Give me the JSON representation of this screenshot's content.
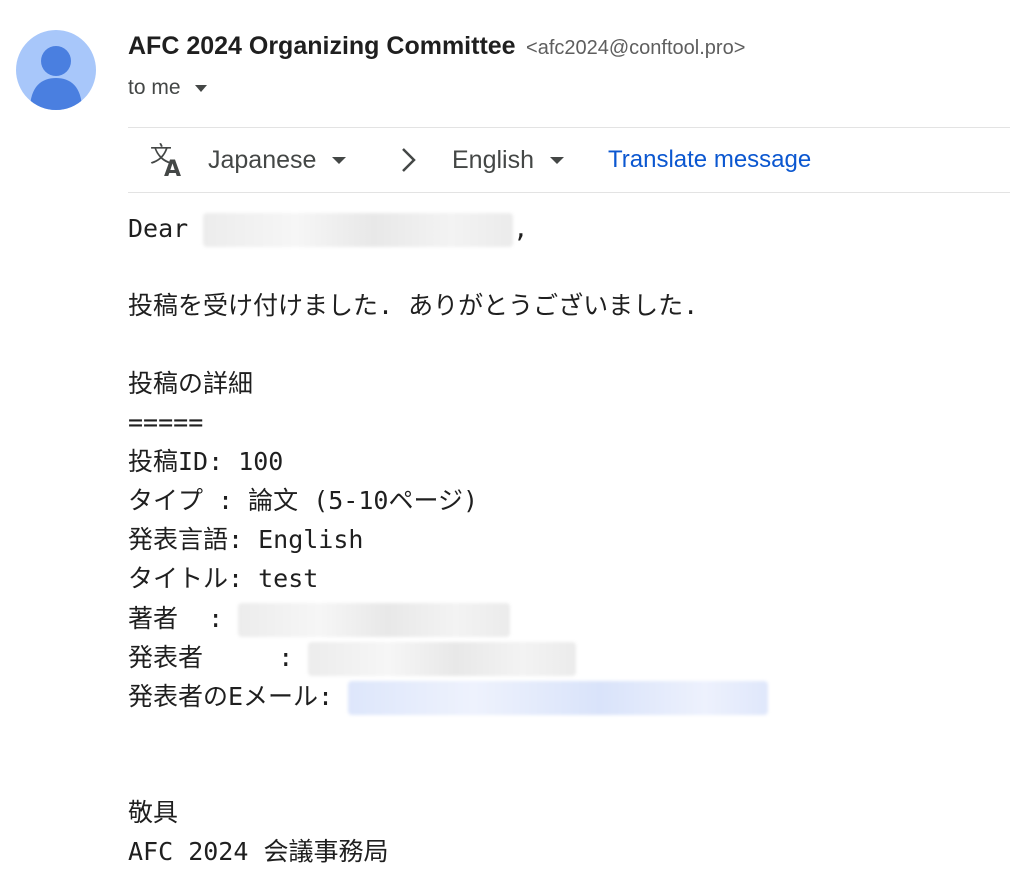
{
  "sender": {
    "name": "AFC 2024 Organizing Committee",
    "email": "<afc2024@conftool.pro>",
    "recipient": "to me"
  },
  "translate_bar": {
    "source_language": "Japanese",
    "target_language": "English",
    "translate_link": "Translate message"
  },
  "message": {
    "greeting": "Dear",
    "greeting_comma": ",",
    "thanks": "投稿を受け付けました. ありがとうございました.",
    "details_heading": "投稿の詳細",
    "separator": "=====",
    "submission_id": "投稿ID: 100",
    "type_line": "タイプ : 論文 (5-10ページ)",
    "language_line": "発表言語: English",
    "title_line": "タイトル: test",
    "author_label": "著者  :",
    "presenter_label": "発表者     :",
    "presenter_email_label": "発表者のEメール:",
    "closing": "敬具",
    "signature": "AFC 2024 会議事務局"
  }
}
